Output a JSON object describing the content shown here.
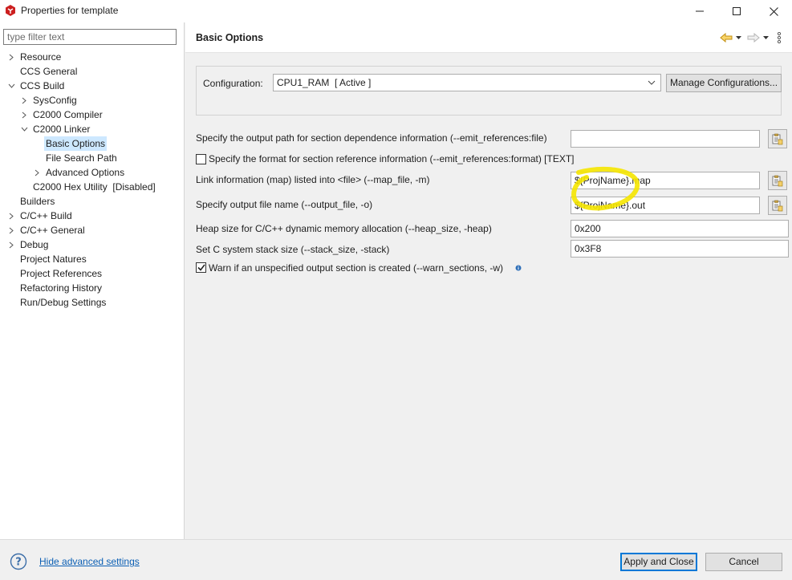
{
  "window": {
    "title": "Properties for template",
    "icons": {
      "app": "ccs-app-icon",
      "minimize": "minimize-icon",
      "maximize": "maximize-icon",
      "close": "close-icon"
    }
  },
  "sidebar": {
    "filter_placeholder": "type filter text",
    "items": [
      {
        "label": "Resource",
        "chevron": "right",
        "selected": false
      },
      {
        "label": "CCS General",
        "chevron": "none",
        "selected": false
      },
      {
        "label": "CCS Build",
        "chevron": "down",
        "selected": false
      },
      {
        "label": "SysConfig",
        "chevron": "right",
        "selected": false
      },
      {
        "label": "C2000 Compiler",
        "chevron": "right",
        "selected": false
      },
      {
        "label": "C2000 Linker",
        "chevron": "down",
        "selected": false
      },
      {
        "label": "Basic Options",
        "chevron": "none",
        "selected": true
      },
      {
        "label": "File Search Path",
        "chevron": "none",
        "selected": false
      },
      {
        "label": "Advanced Options",
        "chevron": "right",
        "selected": false
      },
      {
        "label": "C2000 Hex Utility  [Disabled]",
        "chevron": "none",
        "selected": false
      },
      {
        "label": "Builders",
        "chevron": "none",
        "selected": false
      },
      {
        "label": "C/C++ Build",
        "chevron": "right",
        "selected": false
      },
      {
        "label": "C/C++ General",
        "chevron": "right",
        "selected": false
      },
      {
        "label": "Debug",
        "chevron": "right",
        "selected": false
      },
      {
        "label": "Project Natures",
        "chevron": "none",
        "selected": false
      },
      {
        "label": "Project References",
        "chevron": "none",
        "selected": false
      },
      {
        "label": "Refactoring History",
        "chevron": "none",
        "selected": false
      },
      {
        "label": "Run/Debug Settings",
        "chevron": "none",
        "selected": false
      }
    ]
  },
  "main": {
    "title": "Basic Options",
    "nav_icons": [
      "back-arrow-icon",
      "dropdown-icon",
      "forward-arrow-icon",
      "dropdown-icon",
      "view-menu-icon"
    ],
    "configuration": {
      "label": "Configuration:",
      "value": "CPU1_RAM  [ Active ]",
      "manage_label": "Manage Configurations..."
    },
    "options": {
      "emit_refs_file": {
        "label": "Specify the output path for section dependence information (--emit_references:file)",
        "value": ""
      },
      "emit_refs_format": {
        "label": "Specify the format for section reference information (--emit_references:format) [TEXT]",
        "checked": false
      },
      "map_file": {
        "label": "Link information (map) listed into <file> (--map_file, -m)",
        "value": "${ProjName}.map"
      },
      "output_file": {
        "label": "Specify output file name (--output_file, -o)",
        "value": "${ProjName}.out"
      },
      "heap_size": {
        "label": "Heap size for C/C++ dynamic memory allocation (--heap_size, -heap)",
        "value": "0x200"
      },
      "stack_size": {
        "label": "Set C system stack size (--stack_size, -stack)",
        "value": "0x3F8"
      },
      "warn_sections": {
        "label": "Warn if an unspecified output section is created (--warn_sections, -w)",
        "checked": true
      }
    },
    "highlight_color": "#f5e600"
  },
  "footer": {
    "hide_advanced": "Hide advanced settings",
    "apply_close": "Apply and Close",
    "cancel": "Cancel"
  }
}
